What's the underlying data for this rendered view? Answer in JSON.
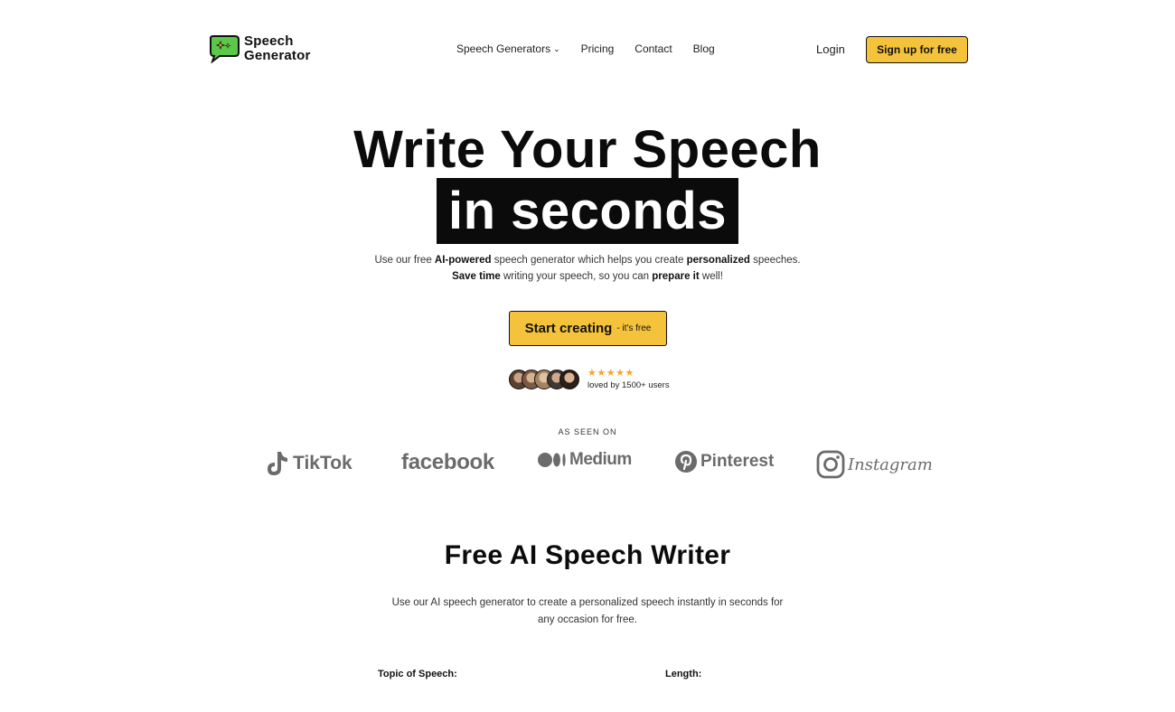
{
  "header": {
    "logo_line1": "Speech",
    "logo_line2": "Generator",
    "nav": [
      {
        "label": "Speech Generators",
        "has_dropdown": true
      },
      {
        "label": "Pricing"
      },
      {
        "label": "Contact"
      },
      {
        "label": "Blog"
      }
    ],
    "login_label": "Login",
    "signup_label": "Sign up for free"
  },
  "hero": {
    "title_line1": "Write Your Speech",
    "title_line2": "in seconds",
    "sub1_a": "Use our free ",
    "sub1_b": "AI-powered",
    "sub1_c": " speech generator which helps you create ",
    "sub1_d": "personalized",
    "sub1_e": " speeches.",
    "sub2_a": "Save time",
    "sub2_b": " writing your speech, so you can ",
    "sub2_c": "prepare it",
    "sub2_d": " well!",
    "cta_main": "Start creating",
    "cta_sub": "- it's free",
    "stars": "★★★★★",
    "loved": "loved by 1500+ users"
  },
  "as_seen_on": {
    "label": "AS SEEN ON",
    "brands": [
      "TikTok",
      "facebook",
      "Medium",
      "Pinterest",
      "Instagram"
    ]
  },
  "writer": {
    "title": "Free AI Speech Writer",
    "desc1": "Use our AI speech generator to create a personalized speech instantly in seconds for",
    "desc2": "any occasion for free.",
    "topic_label": "Topic of Speech:",
    "length_label": "Length:"
  },
  "colors": {
    "accent": "#f5c33b",
    "logo_green": "#5cc84a",
    "star": "#f4a62a",
    "brand_gray": "#6b6b6b"
  }
}
